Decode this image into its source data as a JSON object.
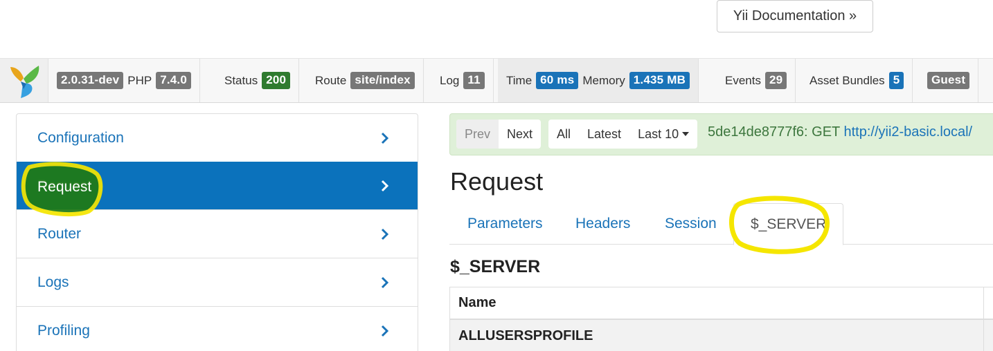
{
  "top": {
    "doc_button": "Yii Documentation »"
  },
  "toolbar": {
    "logo_icon": "yii-logo-icon",
    "version": "2.0.31-dev",
    "php_label": "PHP",
    "php_version": "7.4.0",
    "status_label": "Status",
    "status_value": "200",
    "route_label": "Route",
    "route_value": "site/index",
    "log_label": "Log",
    "log_value": "11",
    "time_label": "Time",
    "time_value": "60 ms",
    "memory_label": "Memory",
    "memory_value": "1.435 MB",
    "events_label": "Events",
    "events_value": "29",
    "assets_label": "Asset Bundles",
    "assets_value": "5",
    "user_value": "Guest",
    "colors": {
      "success": "#2f7b2f",
      "info": "#1a73b8",
      "default": "#777777"
    }
  },
  "sidebar": {
    "items": [
      {
        "label": "Configuration",
        "active": false
      },
      {
        "label": "Request",
        "active": true
      },
      {
        "label": "Router",
        "active": false
      },
      {
        "label": "Logs",
        "active": false
      },
      {
        "label": "Profiling",
        "active": false
      }
    ]
  },
  "pager": {
    "prev": "Prev",
    "next": "Next",
    "all": "All",
    "latest": "Latest",
    "last10": "Last 10",
    "request_prefix": "5de14de8777f6: GET",
    "request_url": "http://yii2-basic.local/"
  },
  "main": {
    "title": "Request",
    "tabs": [
      "Parameters",
      "Headers",
      "Session",
      "$_SERVER"
    ],
    "active_tab": "$_SERVER",
    "section_title": "$_SERVER",
    "table": {
      "header": "Name",
      "rows": [
        "ALLUSERSPROFILE"
      ]
    }
  },
  "annotations": {
    "highlight_color": "#f5e600"
  }
}
